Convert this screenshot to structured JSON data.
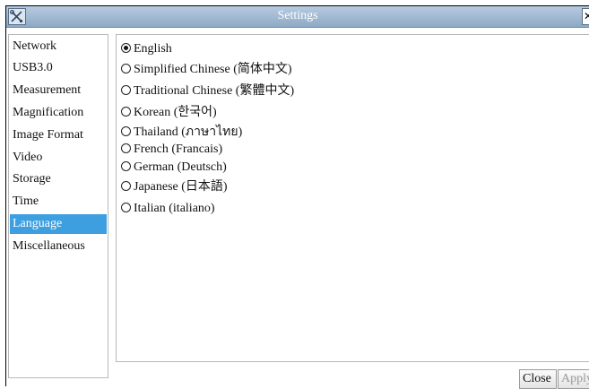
{
  "window": {
    "title": "Settings",
    "close_glyph": "✕",
    "app_icon": "tools-icon"
  },
  "sidebar": {
    "items": [
      {
        "label": "Network"
      },
      {
        "label": "USB3.0"
      },
      {
        "label": "Measurement"
      },
      {
        "label": "Magnification"
      },
      {
        "label": "Image Format"
      },
      {
        "label": "Video"
      },
      {
        "label": "Storage"
      },
      {
        "label": "Time"
      },
      {
        "label": "Language",
        "selected": true
      },
      {
        "label": "Miscellaneous"
      }
    ],
    "active_color": "#3d9fe0"
  },
  "language": {
    "selected": "English",
    "options": [
      {
        "label": "English",
        "checked": true
      },
      {
        "label": "Simplified Chinese (简体中文)",
        "checked": false
      },
      {
        "label": "Traditional Chinese (繁體中文)",
        "checked": false
      },
      {
        "label": "Korean (한국어)",
        "checked": false
      },
      {
        "label": "Thailand (ภาษาไทย)",
        "checked": false
      },
      {
        "label": "French (Francais)",
        "checked": false
      },
      {
        "label": "German (Deutsch)",
        "checked": false
      },
      {
        "label": "Japanese (日本語)",
        "checked": false
      },
      {
        "label": "Italian (italiano)",
        "checked": false
      }
    ]
  },
  "footer": {
    "close_label": "Close",
    "apply_label": "Apply",
    "apply_enabled": false
  }
}
